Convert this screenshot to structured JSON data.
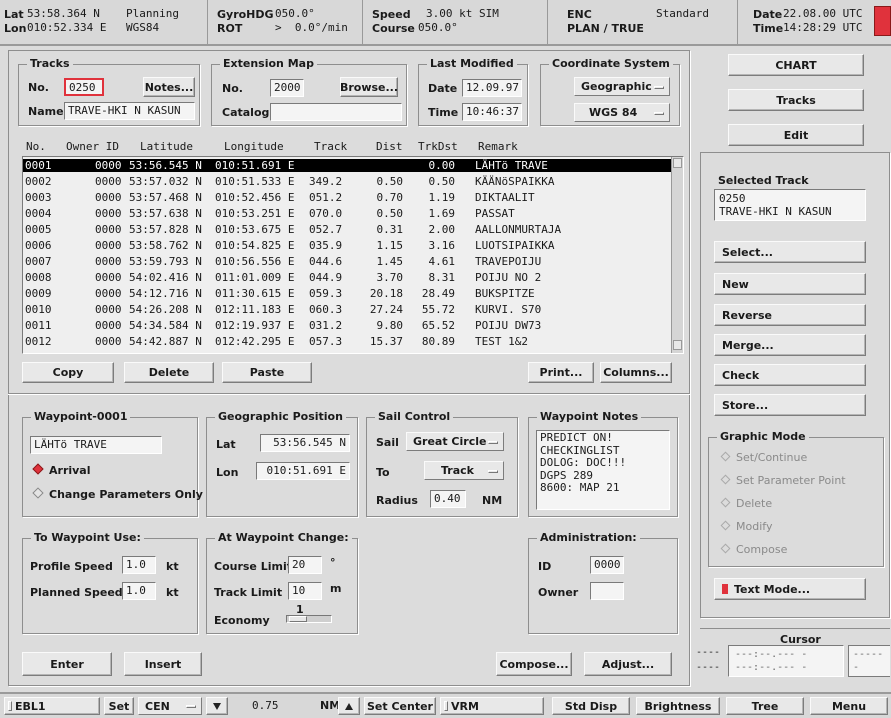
{
  "topbar": {
    "lat_label": "Lat",
    "lon_label": "Lon",
    "lat": "53:58.364 N",
    "lon": "010:52.334 E",
    "mode": "Planning",
    "datum": "WGS84",
    "gyro_label": "GyroHDG",
    "rot_label": "ROT",
    "gyro": "050.0°",
    "rot": ">  0.0°/min",
    "speed_label": "Speed",
    "course_label": "Course",
    "speed": "3.00 kt SIM",
    "course": "050.0°",
    "enc_label": "ENC",
    "enc_mode": "PLAN / TRUE",
    "enc_display": "Standard",
    "date_label": "Date",
    "time_label": "Time",
    "date": "22.08.00 UTC",
    "time": "14:28:29 UTC"
  },
  "tracks": {
    "title": "Tracks",
    "no_label": "No.",
    "no": "0250",
    "notes_button": "Notes...",
    "name_label": "Name",
    "name": "TRAVE-HKI N KASUN"
  },
  "extension_map": {
    "title": "Extension Map",
    "no_label": "No.",
    "no": "2000",
    "browse_button": "Browse...",
    "catalog_label": "Catalog",
    "catalog": ""
  },
  "last_modified": {
    "title": "Last Modified",
    "date_label": "Date",
    "date": "12.09.97",
    "time_label": "Time",
    "time": "10:46:37"
  },
  "coordinate_system": {
    "title": "Coordinate System",
    "type": "Geographic",
    "datum": "WGS 84"
  },
  "table": {
    "columns": [
      "No.",
      "Owner ID",
      "Latitude",
      "Longitude",
      "Track",
      "Dist",
      "TrkDst",
      "Remark"
    ],
    "rows": [
      {
        "no": "0001",
        "owner": "0000",
        "lat": "53:56.545 N",
        "lon": "010:51.691 E",
        "track": "",
        "dist": "",
        "trkdst": "0.00",
        "remark": "LÄHTö TRAVE"
      },
      {
        "no": "0002",
        "owner": "0000",
        "lat": "53:57.032 N",
        "lon": "010:51.533 E",
        "track": "349.2",
        "dist": "0.50",
        "trkdst": "0.50",
        "remark": "KÄÄNöSPAIKKA"
      },
      {
        "no": "0003",
        "owner": "0000",
        "lat": "53:57.468 N",
        "lon": "010:52.456 E",
        "track": "051.2",
        "dist": "0.70",
        "trkdst": "1.19",
        "remark": "DIKTAALIT"
      },
      {
        "no": "0004",
        "owner": "0000",
        "lat": "53:57.638 N",
        "lon": "010:53.251 E",
        "track": "070.0",
        "dist": "0.50",
        "trkdst": "1.69",
        "remark": "PASSAT"
      },
      {
        "no": "0005",
        "owner": "0000",
        "lat": "53:57.828 N",
        "lon": "010:53.675 E",
        "track": "052.7",
        "dist": "0.31",
        "trkdst": "2.00",
        "remark": "AALLONMURTAJA"
      },
      {
        "no": "0006",
        "owner": "0000",
        "lat": "53:58.762 N",
        "lon": "010:54.825 E",
        "track": "035.9",
        "dist": "1.15",
        "trkdst": "3.16",
        "remark": "LUOTSIPAIKKA"
      },
      {
        "no": "0007",
        "owner": "0000",
        "lat": "53:59.793 N",
        "lon": "010:56.556 E",
        "track": "044.6",
        "dist": "1.45",
        "trkdst": "4.61",
        "remark": "TRAVEPOIJU"
      },
      {
        "no": "0008",
        "owner": "0000",
        "lat": "54:02.416 N",
        "lon": "011:01.009 E",
        "track": "044.9",
        "dist": "3.70",
        "trkdst": "8.31",
        "remark": "POIJU NO 2"
      },
      {
        "no": "0009",
        "owner": "0000",
        "lat": "54:12.716 N",
        "lon": "011:30.615 E",
        "track": "059.3",
        "dist": "20.18",
        "trkdst": "28.49",
        "remark": "BUKSPITZE"
      },
      {
        "no": "0010",
        "owner": "0000",
        "lat": "54:26.208 N",
        "lon": "012:11.183 E",
        "track": "060.3",
        "dist": "27.24",
        "trkdst": "55.72",
        "remark": "KURVI. S70"
      },
      {
        "no": "0011",
        "owner": "0000",
        "lat": "54:34.584 N",
        "lon": "012:19.937 E",
        "track": "031.2",
        "dist": "9.80",
        "trkdst": "65.52",
        "remark": "POIJU DW73"
      },
      {
        "no": "0012",
        "owner": "0000",
        "lat": "54:42.887 N",
        "lon": "012:42.295 E",
        "track": "057.3",
        "dist": "15.37",
        "trkdst": "80.89",
        "remark": "TEST 1&2"
      }
    ]
  },
  "table_buttons": {
    "copy": "Copy",
    "delete": "Delete",
    "paste": "Paste",
    "print": "Print...",
    "columns": "Columns..."
  },
  "waypoint": {
    "title": "Waypoint-0001",
    "name": "LÄHTö TRAVE",
    "arrival": "Arrival",
    "change_params": "Change Parameters Only"
  },
  "geo_position": {
    "title": "Geographic Position",
    "lat_label": "Lat",
    "lat": "53:56.545 N",
    "lon_label": "Lon",
    "lon": "010:51.691 E"
  },
  "sail_control": {
    "title": "Sail Control",
    "sail_label": "Sail",
    "sail": "Great Circle",
    "to_label": "To",
    "to": "Track",
    "radius_label": "Radius",
    "radius": "0.40",
    "radius_unit": "NM"
  },
  "waypoint_notes": {
    "title": "Waypoint Notes",
    "lines": [
      "PREDICT ON!",
      "CHECKINGLIST",
      "DOLOG: DOC!!!",
      "DGPS 289",
      "8600: MAP 21"
    ]
  },
  "to_waypoint_use": {
    "title": "To Waypoint Use:",
    "profile_label": "Profile Speed",
    "profile": "1.0",
    "profile_unit": "kt",
    "planned_label": "Planned Speed",
    "planned": "1.0",
    "planned_unit": "kt"
  },
  "at_waypoint_change": {
    "title": "At Waypoint Change:",
    "course_label": "Course Limit",
    "course": "20",
    "course_unit": "°",
    "track_label": "Track Limit",
    "track": "10",
    "track_unit": "m",
    "economy_label": "Economy",
    "economy_value": "1"
  },
  "administration": {
    "title": "Administration:",
    "id_label": "ID",
    "id": "0000",
    "owner_label": "Owner",
    "owner": ""
  },
  "bottom_buttons": {
    "enter": "Enter",
    "insert": "Insert",
    "compose": "Compose...",
    "adjust": "Adjust..."
  },
  "right_panel": {
    "chart": "CHART",
    "tracks": "Tracks",
    "edit": "Edit",
    "selected_track_label": "Selected Track",
    "selected_track_no": "0250",
    "selected_track_name": "TRAVE-HKI N KASUN",
    "select": "Select...",
    "new": "New",
    "reverse": "Reverse",
    "merge": "Merge...",
    "check": "Check",
    "store": "Store...",
    "graphic_mode_title": "Graphic Mode",
    "graphic_modes": [
      "Set/Continue",
      "Set Parameter Point",
      "Delete",
      "Modify",
      "Compose"
    ],
    "text_mode": "Text Mode...",
    "cursor_title": "Cursor",
    "cursor_line1": "---:--.--- -",
    "cursor_line2": "---:--.--- -",
    "cursor_left1": "----",
    "cursor_left2": "----",
    "cursor_right1": "----- -",
    "cursor_right2": "----- -"
  },
  "statusbar": {
    "ebl": "EBL1",
    "set": "Set",
    "cen": "CEN",
    "range": "0.75",
    "range_unit": "NM",
    "set_center": "Set Center",
    "vrm": "VRM",
    "std_disp": "Std Disp",
    "brightness": "Brightness",
    "tree": "Tree",
    "menu": "Menu"
  },
  "colors": {
    "background": "#dcdcdc",
    "selection": "#000000",
    "accent_red": "#e0323c"
  }
}
